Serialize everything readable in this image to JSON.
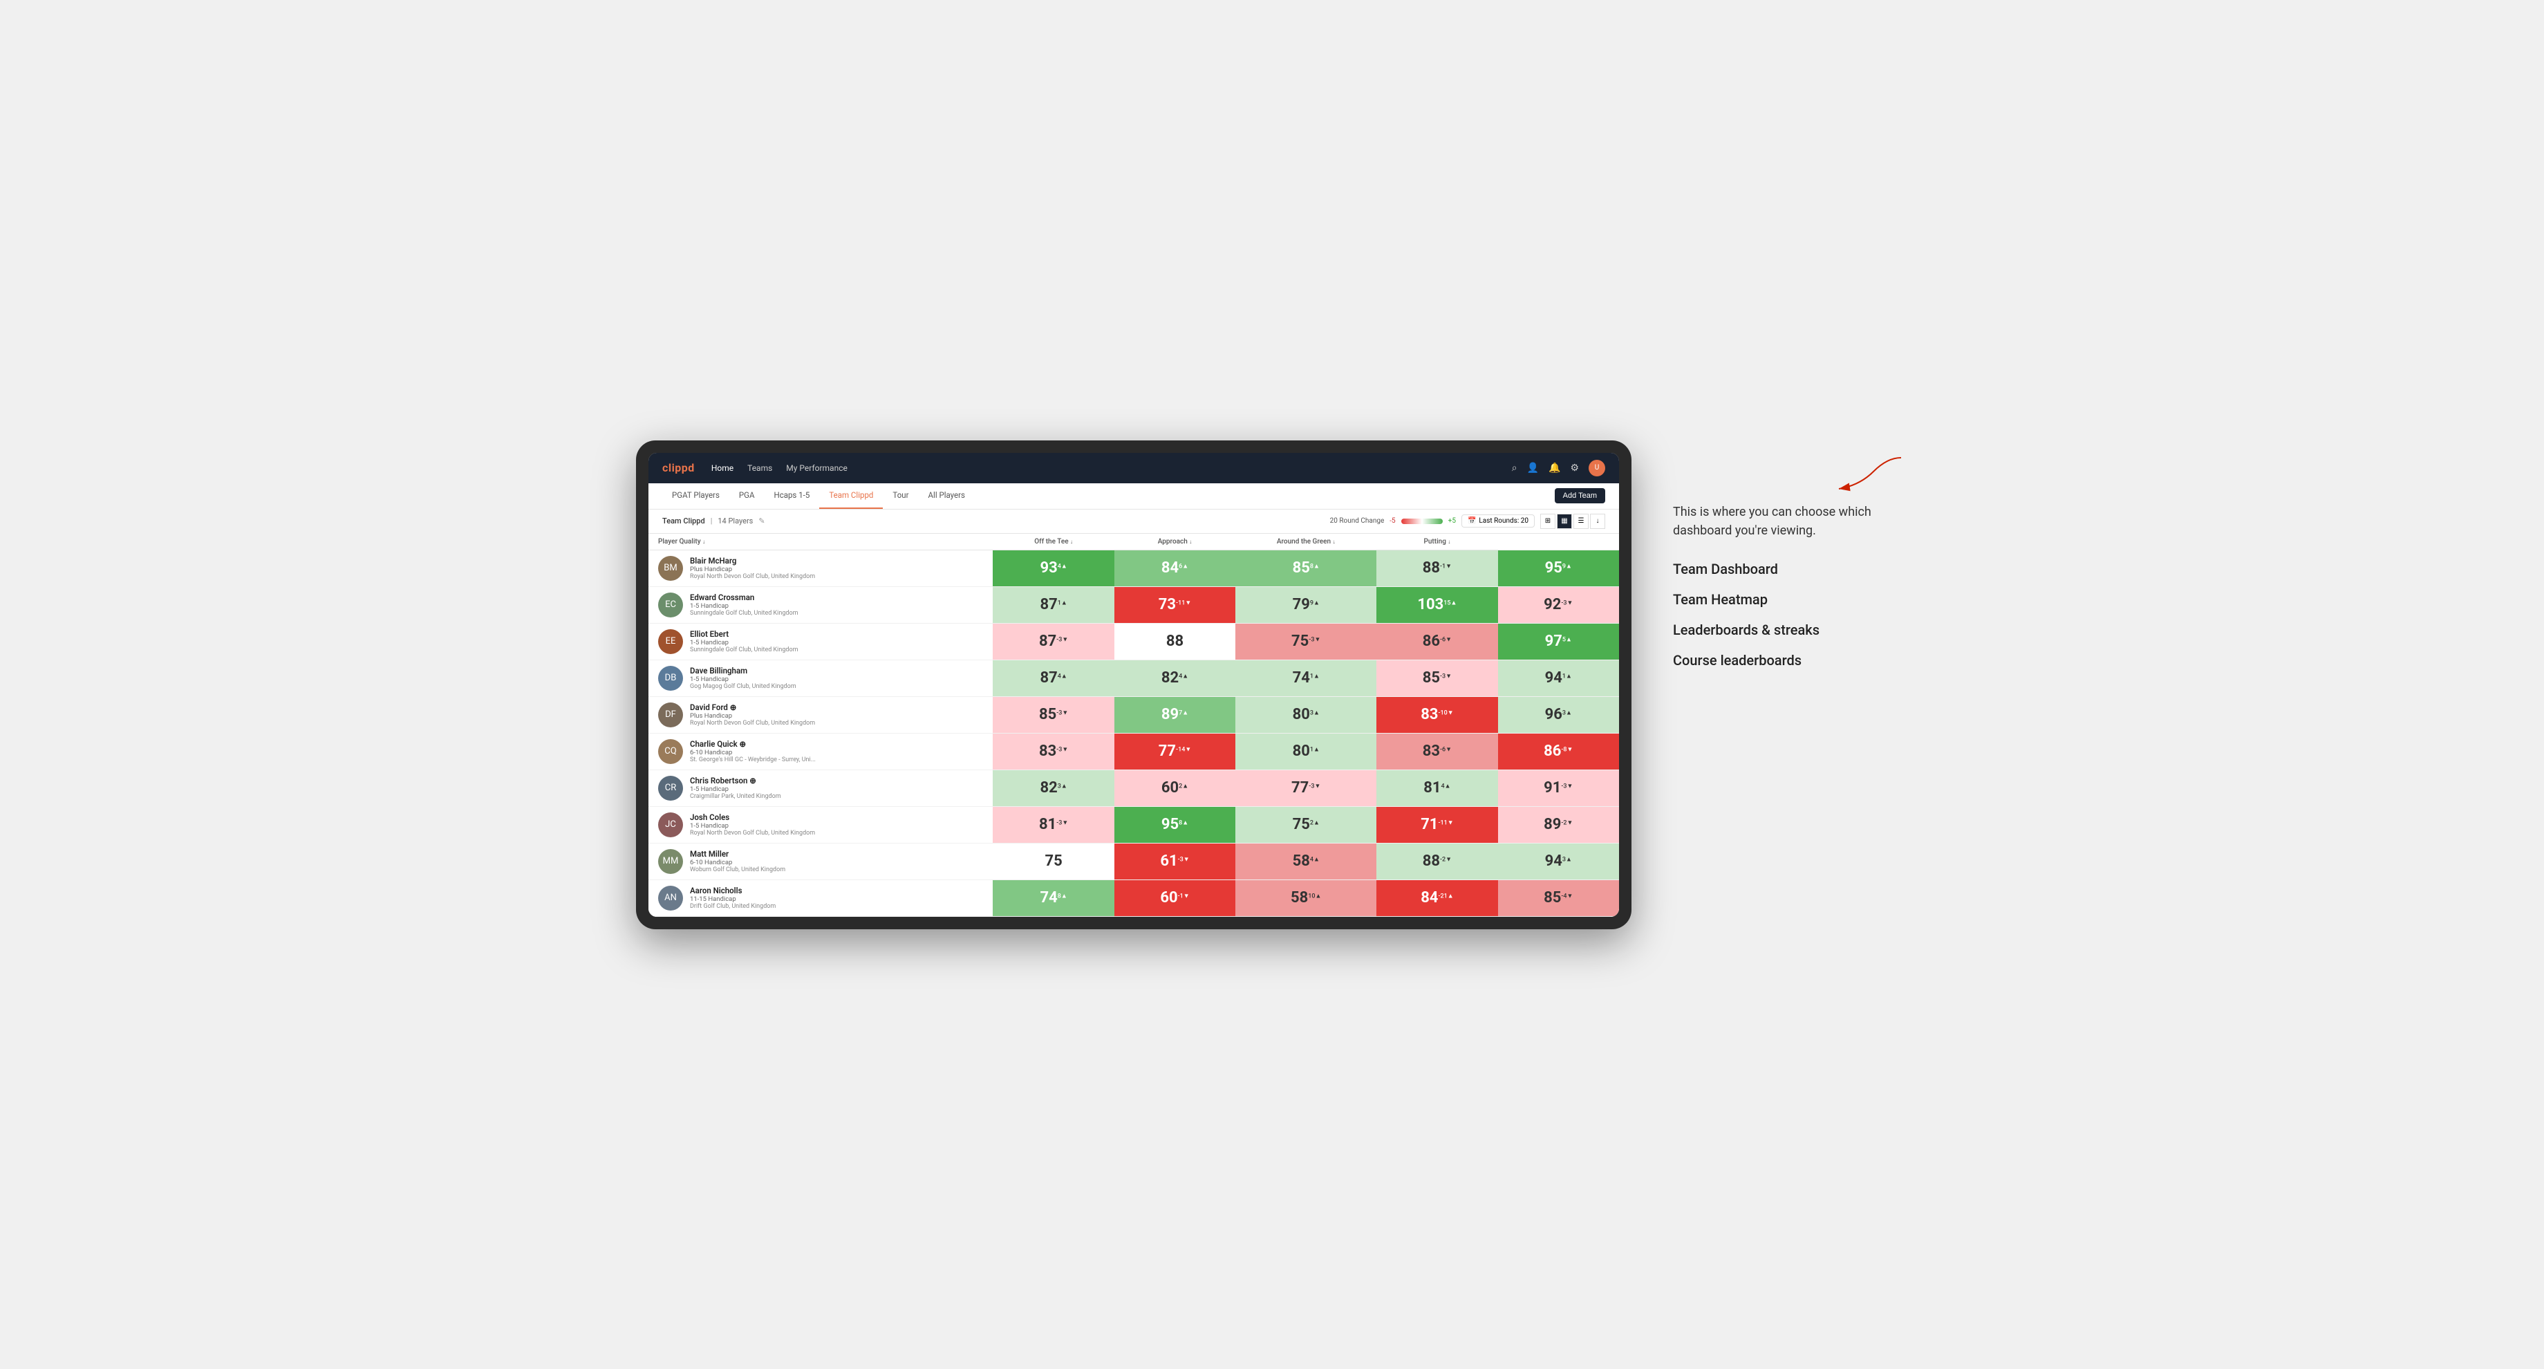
{
  "nav": {
    "logo": "clippd",
    "links": [
      "Home",
      "Teams",
      "My Performance"
    ],
    "icons": [
      "search",
      "user",
      "bell",
      "settings",
      "avatar"
    ]
  },
  "sub_nav": {
    "items": [
      "PGAT Players",
      "PGA",
      "Hcaps 1-5",
      "Team Clippd",
      "Tour",
      "All Players"
    ],
    "active": "Team Clippd",
    "add_team_label": "Add Team"
  },
  "team_bar": {
    "name": "Team Clippd",
    "count": "14 Players",
    "round_change_label": "20 Round Change",
    "range_neg": "-5",
    "range_pos": "+5",
    "last_rounds_label": "Last Rounds:",
    "last_rounds_value": "20"
  },
  "table": {
    "headers": [
      "Player Quality ↓",
      "Off the Tee ↓",
      "Approach ↓",
      "Around the Green ↓",
      "Putting ↓"
    ],
    "rows": [
      {
        "name": "Blair McHarg",
        "hcp": "Plus Handicap",
        "club": "Royal North Devon Golf Club, United Kingdom",
        "avatar_color": "#8B7355",
        "initials": "BM",
        "scores": [
          {
            "value": "93",
            "delta": "4▲",
            "color": "green-dark"
          },
          {
            "value": "84",
            "delta": "6▲",
            "color": "green-med"
          },
          {
            "value": "85",
            "delta": "8▲",
            "color": "green-med"
          },
          {
            "value": "88",
            "delta": "-1▼",
            "color": "green-light"
          },
          {
            "value": "95",
            "delta": "9▲",
            "color": "green-dark"
          }
        ]
      },
      {
        "name": "Edward Crossman",
        "hcp": "1-5 Handicap",
        "club": "Sunningdale Golf Club, United Kingdom",
        "avatar_color": "#6B8E6B",
        "initials": "EC",
        "scores": [
          {
            "value": "87",
            "delta": "1▲",
            "color": "green-light"
          },
          {
            "value": "73",
            "delta": "-11▼",
            "color": "red-dark"
          },
          {
            "value": "79",
            "delta": "9▲",
            "color": "green-light"
          },
          {
            "value": "103",
            "delta": "15▲",
            "color": "green-dark"
          },
          {
            "value": "92",
            "delta": "-3▼",
            "color": "red-light"
          }
        ]
      },
      {
        "name": "Elliot Ebert",
        "hcp": "1-5 Handicap",
        "club": "Sunningdale Golf Club, United Kingdom",
        "avatar_color": "#A0522D",
        "initials": "EE",
        "scores": [
          {
            "value": "87",
            "delta": "-3▼",
            "color": "red-light"
          },
          {
            "value": "88",
            "delta": "",
            "color": "white-cell"
          },
          {
            "value": "75",
            "delta": "-3▼",
            "color": "red-med"
          },
          {
            "value": "86",
            "delta": "-6▼",
            "color": "red-med"
          },
          {
            "value": "97",
            "delta": "5▲",
            "color": "green-dark"
          }
        ]
      },
      {
        "name": "Dave Billingham",
        "hcp": "1-5 Handicap",
        "club": "Gog Magog Golf Club, United Kingdom",
        "avatar_color": "#5B7B9A",
        "initials": "DB",
        "scores": [
          {
            "value": "87",
            "delta": "4▲",
            "color": "green-light"
          },
          {
            "value": "82",
            "delta": "4▲",
            "color": "green-light"
          },
          {
            "value": "74",
            "delta": "1▲",
            "color": "green-light"
          },
          {
            "value": "85",
            "delta": "-3▼",
            "color": "red-light"
          },
          {
            "value": "94",
            "delta": "1▲",
            "color": "green-light"
          }
        ]
      },
      {
        "name": "David Ford ⊕",
        "hcp": "Plus Handicap",
        "club": "Royal North Devon Golf Club, United Kingdom",
        "avatar_color": "#7B6B5A",
        "initials": "DF",
        "scores": [
          {
            "value": "85",
            "delta": "-3▼",
            "color": "red-light"
          },
          {
            "value": "89",
            "delta": "7▲",
            "color": "green-med"
          },
          {
            "value": "80",
            "delta": "3▲",
            "color": "green-light"
          },
          {
            "value": "83",
            "delta": "-10▼",
            "color": "red-dark"
          },
          {
            "value": "96",
            "delta": "3▲",
            "color": "green-light"
          }
        ]
      },
      {
        "name": "Charlie Quick ⊕",
        "hcp": "6-10 Handicap",
        "club": "St. George's Hill GC - Weybridge - Surrey, Uni...",
        "avatar_color": "#9A7B5A",
        "initials": "CQ",
        "scores": [
          {
            "value": "83",
            "delta": "-3▼",
            "color": "red-light"
          },
          {
            "value": "77",
            "delta": "-14▼",
            "color": "red-dark"
          },
          {
            "value": "80",
            "delta": "1▲",
            "color": "green-light"
          },
          {
            "value": "83",
            "delta": "-6▼",
            "color": "red-med"
          },
          {
            "value": "86",
            "delta": "-8▼",
            "color": "red-dark"
          }
        ]
      },
      {
        "name": "Chris Robertson ⊕",
        "hcp": "1-5 Handicap",
        "club": "Craigmillar Park, United Kingdom",
        "avatar_color": "#5A6B7B",
        "initials": "CR",
        "scores": [
          {
            "value": "82",
            "delta": "3▲",
            "color": "green-light"
          },
          {
            "value": "60",
            "delta": "2▲",
            "color": "red-light"
          },
          {
            "value": "77",
            "delta": "-3▼",
            "color": "red-light"
          },
          {
            "value": "81",
            "delta": "4▲",
            "color": "green-light"
          },
          {
            "value": "91",
            "delta": "-3▼",
            "color": "red-light"
          }
        ]
      },
      {
        "name": "Josh Coles",
        "hcp": "1-5 Handicap",
        "club": "Royal North Devon Golf Club, United Kingdom",
        "avatar_color": "#8B5A5A",
        "initials": "JC",
        "scores": [
          {
            "value": "81",
            "delta": "-3▼",
            "color": "red-light"
          },
          {
            "value": "95",
            "delta": "8▲",
            "color": "green-dark"
          },
          {
            "value": "75",
            "delta": "2▲",
            "color": "green-light"
          },
          {
            "value": "71",
            "delta": "-11▼",
            "color": "red-dark"
          },
          {
            "value": "89",
            "delta": "-2▼",
            "color": "red-light"
          }
        ]
      },
      {
        "name": "Matt Miller",
        "hcp": "6-10 Handicap",
        "club": "Woburn Golf Club, United Kingdom",
        "avatar_color": "#7A8B6A",
        "initials": "MM",
        "scores": [
          {
            "value": "75",
            "delta": "",
            "color": "white-cell"
          },
          {
            "value": "61",
            "delta": "-3▼",
            "color": "red-dark"
          },
          {
            "value": "58",
            "delta": "4▲",
            "color": "red-med"
          },
          {
            "value": "88",
            "delta": "-2▼",
            "color": "green-light"
          },
          {
            "value": "94",
            "delta": "3▲",
            "color": "green-light"
          }
        ]
      },
      {
        "name": "Aaron Nicholls",
        "hcp": "11-15 Handicap",
        "club": "Drift Golf Club, United Kingdom",
        "avatar_color": "#6A7A8B",
        "initials": "AN",
        "scores": [
          {
            "value": "74",
            "delta": "8▲",
            "color": "green-med"
          },
          {
            "value": "60",
            "delta": "-1▼",
            "color": "red-dark"
          },
          {
            "value": "58",
            "delta": "10▲",
            "color": "red-med"
          },
          {
            "value": "84",
            "delta": "-21▲",
            "color": "red-dark"
          },
          {
            "value": "85",
            "delta": "-4▼",
            "color": "red-med"
          }
        ]
      }
    ]
  },
  "annotation": {
    "intro": "This is where you can choose which dashboard you're viewing.",
    "items": [
      "Team Dashboard",
      "Team Heatmap",
      "Leaderboards & streaks",
      "Course leaderboards"
    ]
  }
}
